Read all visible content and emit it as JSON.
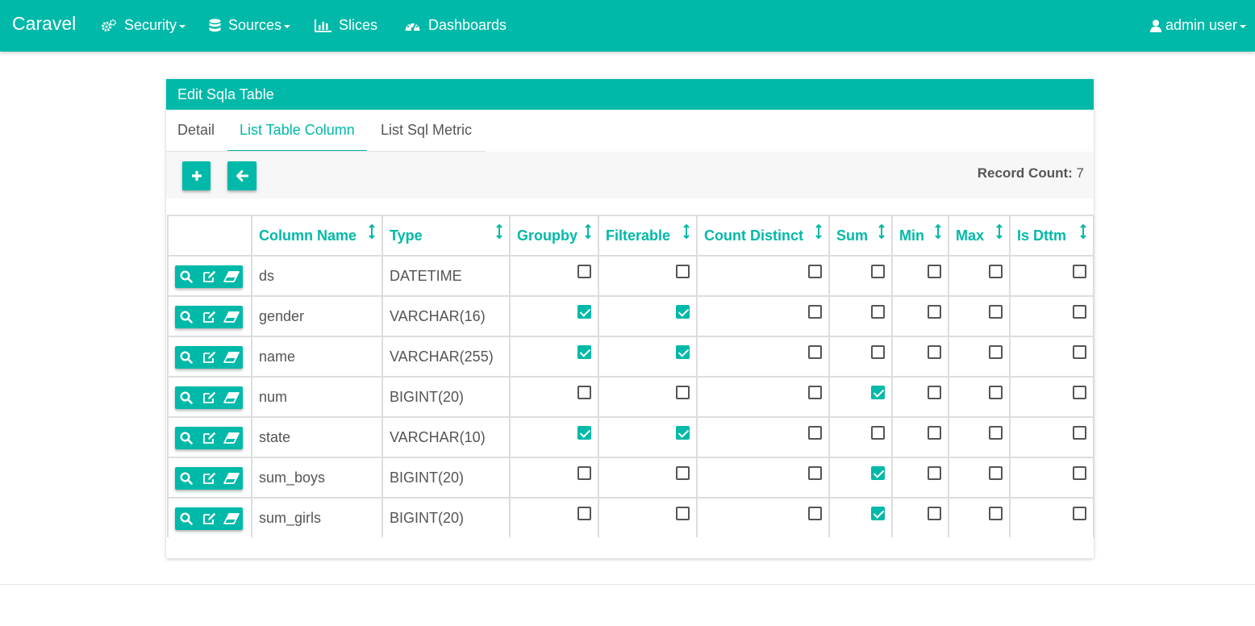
{
  "app": {
    "brand": "Caravel"
  },
  "nav": {
    "security": "Security",
    "sources": "Sources",
    "slices": "Slices",
    "dashboards": "Dashboards",
    "user": "admin user"
  },
  "panel": {
    "title": "Edit Sqla Table",
    "tabs": [
      "Detail",
      "List Table Column",
      "List Sql Metric"
    ],
    "active_tab": "List Table Column"
  },
  "toolbar": {
    "record_count_label": "Record Count:",
    "record_count": "7"
  },
  "table": {
    "columns": [
      "Column Name",
      "Type",
      "Groupby",
      "Filterable",
      "Count Distinct",
      "Sum",
      "Min",
      "Max",
      "Is Dttm"
    ],
    "rows": [
      {
        "name": "ds",
        "type": "DATETIME",
        "flags": [
          false,
          false,
          false,
          false,
          false,
          false,
          false
        ]
      },
      {
        "name": "gender",
        "type": "VARCHAR(16)",
        "flags": [
          true,
          true,
          false,
          false,
          false,
          false,
          false
        ]
      },
      {
        "name": "name",
        "type": "VARCHAR(255)",
        "flags": [
          true,
          true,
          false,
          false,
          false,
          false,
          false
        ]
      },
      {
        "name": "num",
        "type": "BIGINT(20)",
        "flags": [
          false,
          false,
          false,
          true,
          false,
          false,
          false
        ]
      },
      {
        "name": "state",
        "type": "VARCHAR(10)",
        "flags": [
          true,
          true,
          false,
          false,
          false,
          false,
          false
        ]
      },
      {
        "name": "sum_boys",
        "type": "BIGINT(20)",
        "flags": [
          false,
          false,
          false,
          true,
          false,
          false,
          false
        ]
      },
      {
        "name": "sum_girls",
        "type": "BIGINT(20)",
        "flags": [
          false,
          false,
          false,
          true,
          false,
          false,
          false
        ]
      }
    ]
  },
  "colors": {
    "accent": "#00b9a8",
    "text": "#555555",
    "border": "#dddddd"
  }
}
